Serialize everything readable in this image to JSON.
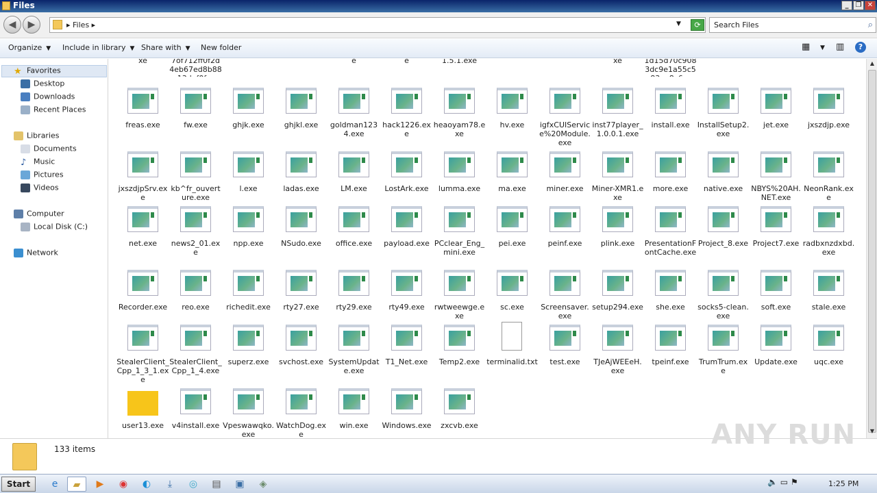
{
  "window": {
    "title": "Files"
  },
  "address": {
    "crumb": "Files"
  },
  "search": {
    "placeholder": "Search Files"
  },
  "toolbar": {
    "organize": "Organize",
    "include": "Include in library",
    "share": "Share with",
    "newfolder": "New folder"
  },
  "sidebar": {
    "favorites": "Favorites",
    "desktop": "Desktop",
    "downloads": "Downloads",
    "recent": "Recent Places",
    "libraries": "Libraries",
    "documents": "Documents",
    "music": "Music",
    "pictures": "Pictures",
    "videos": "Videos",
    "computer": "Computer",
    "localdisk": "Local Disk (C:)",
    "network": "Network"
  },
  "partial_top": [
    "xe",
    "7of712ff0f2d4eb67ed8b8813daf0f…",
    "e",
    "e",
    "1.5.1.exe",
    "xe",
    "1d15d70c9083dc9e1a55c583ea8c6…"
  ],
  "files": [
    [
      "freas.exe",
      "fw.exe",
      "ghjk.exe",
      "ghjkl.exe",
      "goldman1234.exe",
      "hack1226.exe",
      "heaoyam78.exe",
      "hv.exe",
      "igfxCUIService%20Module.exe",
      "inst77player_1.0.0.1.exe",
      "install.exe",
      "InstallSetup2.exe",
      "jet.exe",
      "jxszdjp.exe"
    ],
    [
      "jxszdjpSrv.exe",
      "kb^fr_ouverture.exe",
      "l.exe",
      "ladas.exe",
      "LM.exe",
      "LostArk.exe",
      "lumma.exe",
      "ma.exe",
      "miner.exe",
      "Miner-XMR1.exe",
      "more.exe",
      "native.exe",
      "NBYS%20AH.NET.exe",
      "NeonRank.exe"
    ],
    [
      "net.exe",
      "news2_01.exe",
      "npp.exe",
      "NSudo.exe",
      "office.exe",
      "payload.exe",
      "PCclear_Eng_mini.exe",
      "pei.exe",
      "peinf.exe",
      "plink.exe",
      "PresentationFontCache.exe",
      "Project_8.exe",
      "Project7.exe",
      "radbxnzdxbd.exe"
    ],
    [
      "Recorder.exe",
      "reo.exe",
      "richedit.exe",
      "rty27.exe",
      "rty29.exe",
      "rty49.exe",
      "rwtweewge.exe",
      "sc.exe",
      "Screensaver.exe",
      "setup294.exe",
      "she.exe",
      "socks5-clean.exe",
      "soft.exe",
      "stale.exe"
    ],
    [
      "StealerClient_Cpp_1_3_1.exe",
      "StealerClient_Cpp_1_4.exe",
      "superz.exe",
      "svchost.exe",
      "SystemUpdate.exe",
      "T1_Net.exe",
      "Temp2.exe",
      "terminalid.txt",
      "test.exe",
      "TJeAjWEEeH.exe",
      "tpeinf.exe",
      "TrumTrum.exe",
      "Update.exe",
      "uqc.exe"
    ],
    [
      "user13.exe",
      "v4install.exe",
      "Vpeswawqko.exe",
      "WatchDog.exe",
      "win.exe",
      "Windows.exe",
      "zxcvb.exe"
    ]
  ],
  "status": {
    "count": "133 items"
  },
  "watermark": "ANY RUN",
  "taskbar": {
    "start": "Start",
    "clock": "1:25 PM"
  }
}
